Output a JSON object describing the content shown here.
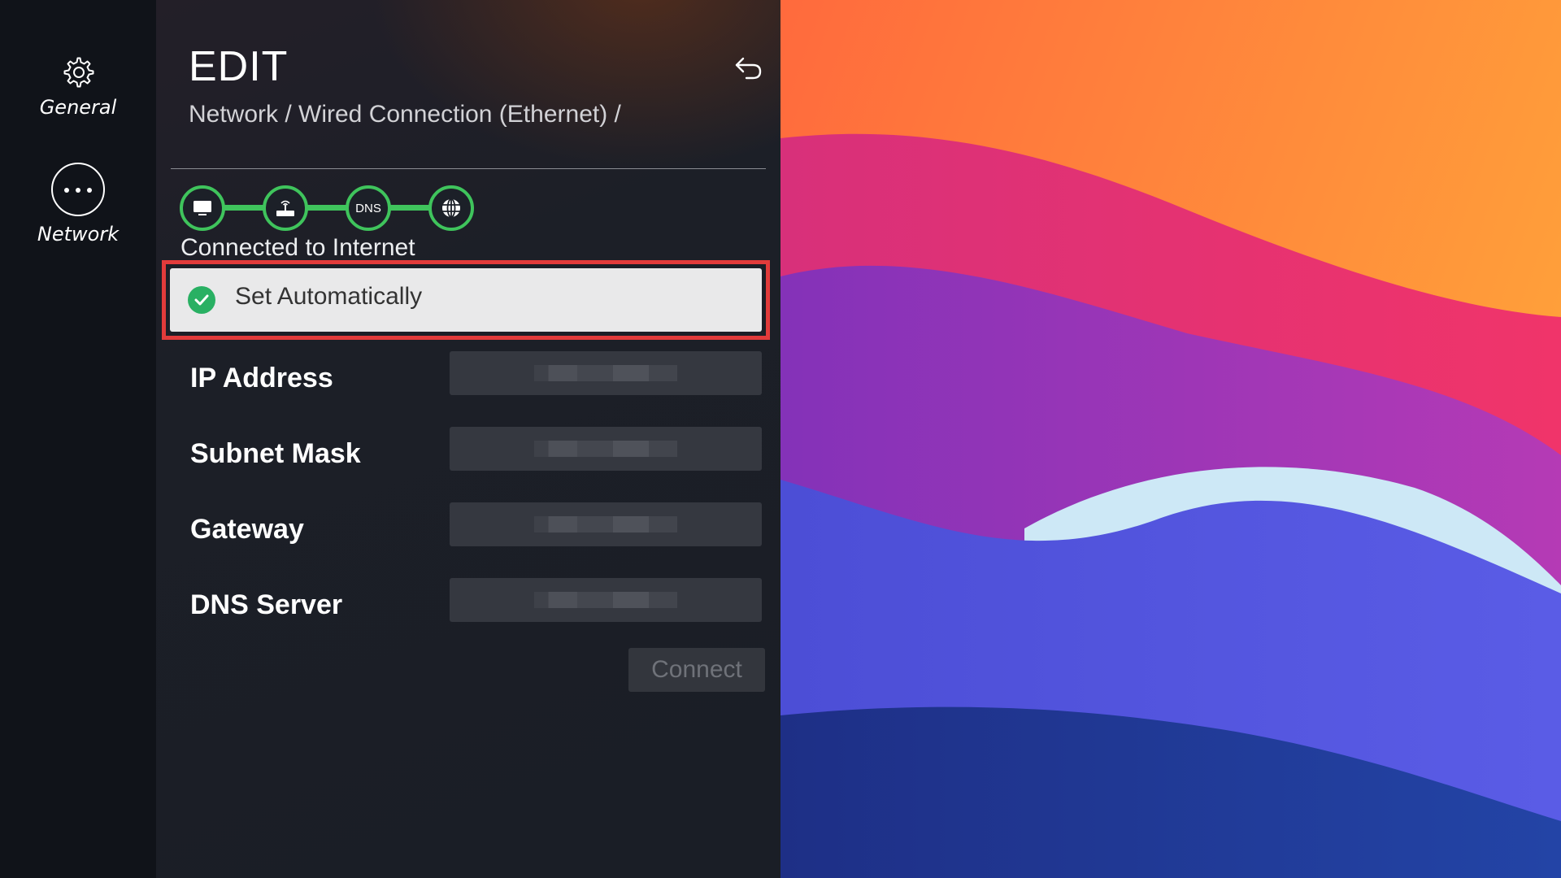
{
  "nav": {
    "items": [
      {
        "label": "General",
        "icon": "gear-icon"
      },
      {
        "label": "Network",
        "icon": "more-dots-icon"
      }
    ]
  },
  "header": {
    "title": "EDIT",
    "breadcrumb": "Network / Wired Connection (Ethernet) /",
    "back_icon": "back-arrow-icon"
  },
  "connection_chain": {
    "nodes": [
      "tv-icon",
      "router-icon",
      "DNS",
      "globe-icon"
    ],
    "color": "#3fc45c",
    "status": "Connected to Internet"
  },
  "set_automatically": {
    "label": "Set Automatically",
    "checked": true
  },
  "fields": [
    {
      "label": "IP Address",
      "value": ""
    },
    {
      "label": "Subnet Mask",
      "value": ""
    },
    {
      "label": "Gateway",
      "value": ""
    },
    {
      "label": "DNS Server",
      "value": ""
    }
  ],
  "connect_button": {
    "label": "Connect",
    "enabled": false
  },
  "colors": {
    "highlight": "#e23b3b",
    "check": "#29b063"
  }
}
